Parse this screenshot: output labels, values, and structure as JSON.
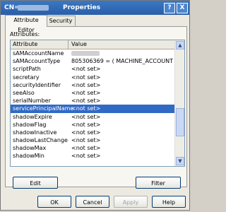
{
  "window": {
    "title_prefix": "CN=",
    "title": "Properties",
    "help_glyph": "?",
    "close_glyph": "X"
  },
  "tabs": [
    {
      "label": "Attribute Editor",
      "active": true
    },
    {
      "label": "Security",
      "active": false
    }
  ],
  "attributes_label": "Attributes:",
  "table": {
    "columns": [
      "Attribute",
      "Value"
    ],
    "rows": [
      {
        "attribute": "sAMAccountName",
        "value": ""
      },
      {
        "attribute": "sAMAccountType",
        "value": "805306369 = ( MACHINE_ACCOUNT )"
      },
      {
        "attribute": "scriptPath",
        "value": "<not set>"
      },
      {
        "attribute": "secretary",
        "value": "<not set>"
      },
      {
        "attribute": "securityIdentifier",
        "value": "<not set>"
      },
      {
        "attribute": "seeAlso",
        "value": "<not set>"
      },
      {
        "attribute": "serialNumber",
        "value": "<not set>"
      },
      {
        "attribute": "servicePrincipalName",
        "value": "<not set>",
        "selected": true
      },
      {
        "attribute": "shadowExpire",
        "value": "<not set>"
      },
      {
        "attribute": "shadowFlag",
        "value": "<not set>"
      },
      {
        "attribute": "shadowInactive",
        "value": "<not set>"
      },
      {
        "attribute": "shadowLastChange",
        "value": "<not set>"
      },
      {
        "attribute": "shadowMax",
        "value": "<not set>"
      },
      {
        "attribute": "shadowMin",
        "value": "<not set>"
      }
    ]
  },
  "scrollbar": {
    "up_glyph": "▲",
    "down_glyph": "▼"
  },
  "buttons": {
    "edit": "Edit",
    "filter": "Filter",
    "ok": "OK",
    "cancel": "Cancel",
    "apply": "Apply",
    "help": "Help"
  }
}
